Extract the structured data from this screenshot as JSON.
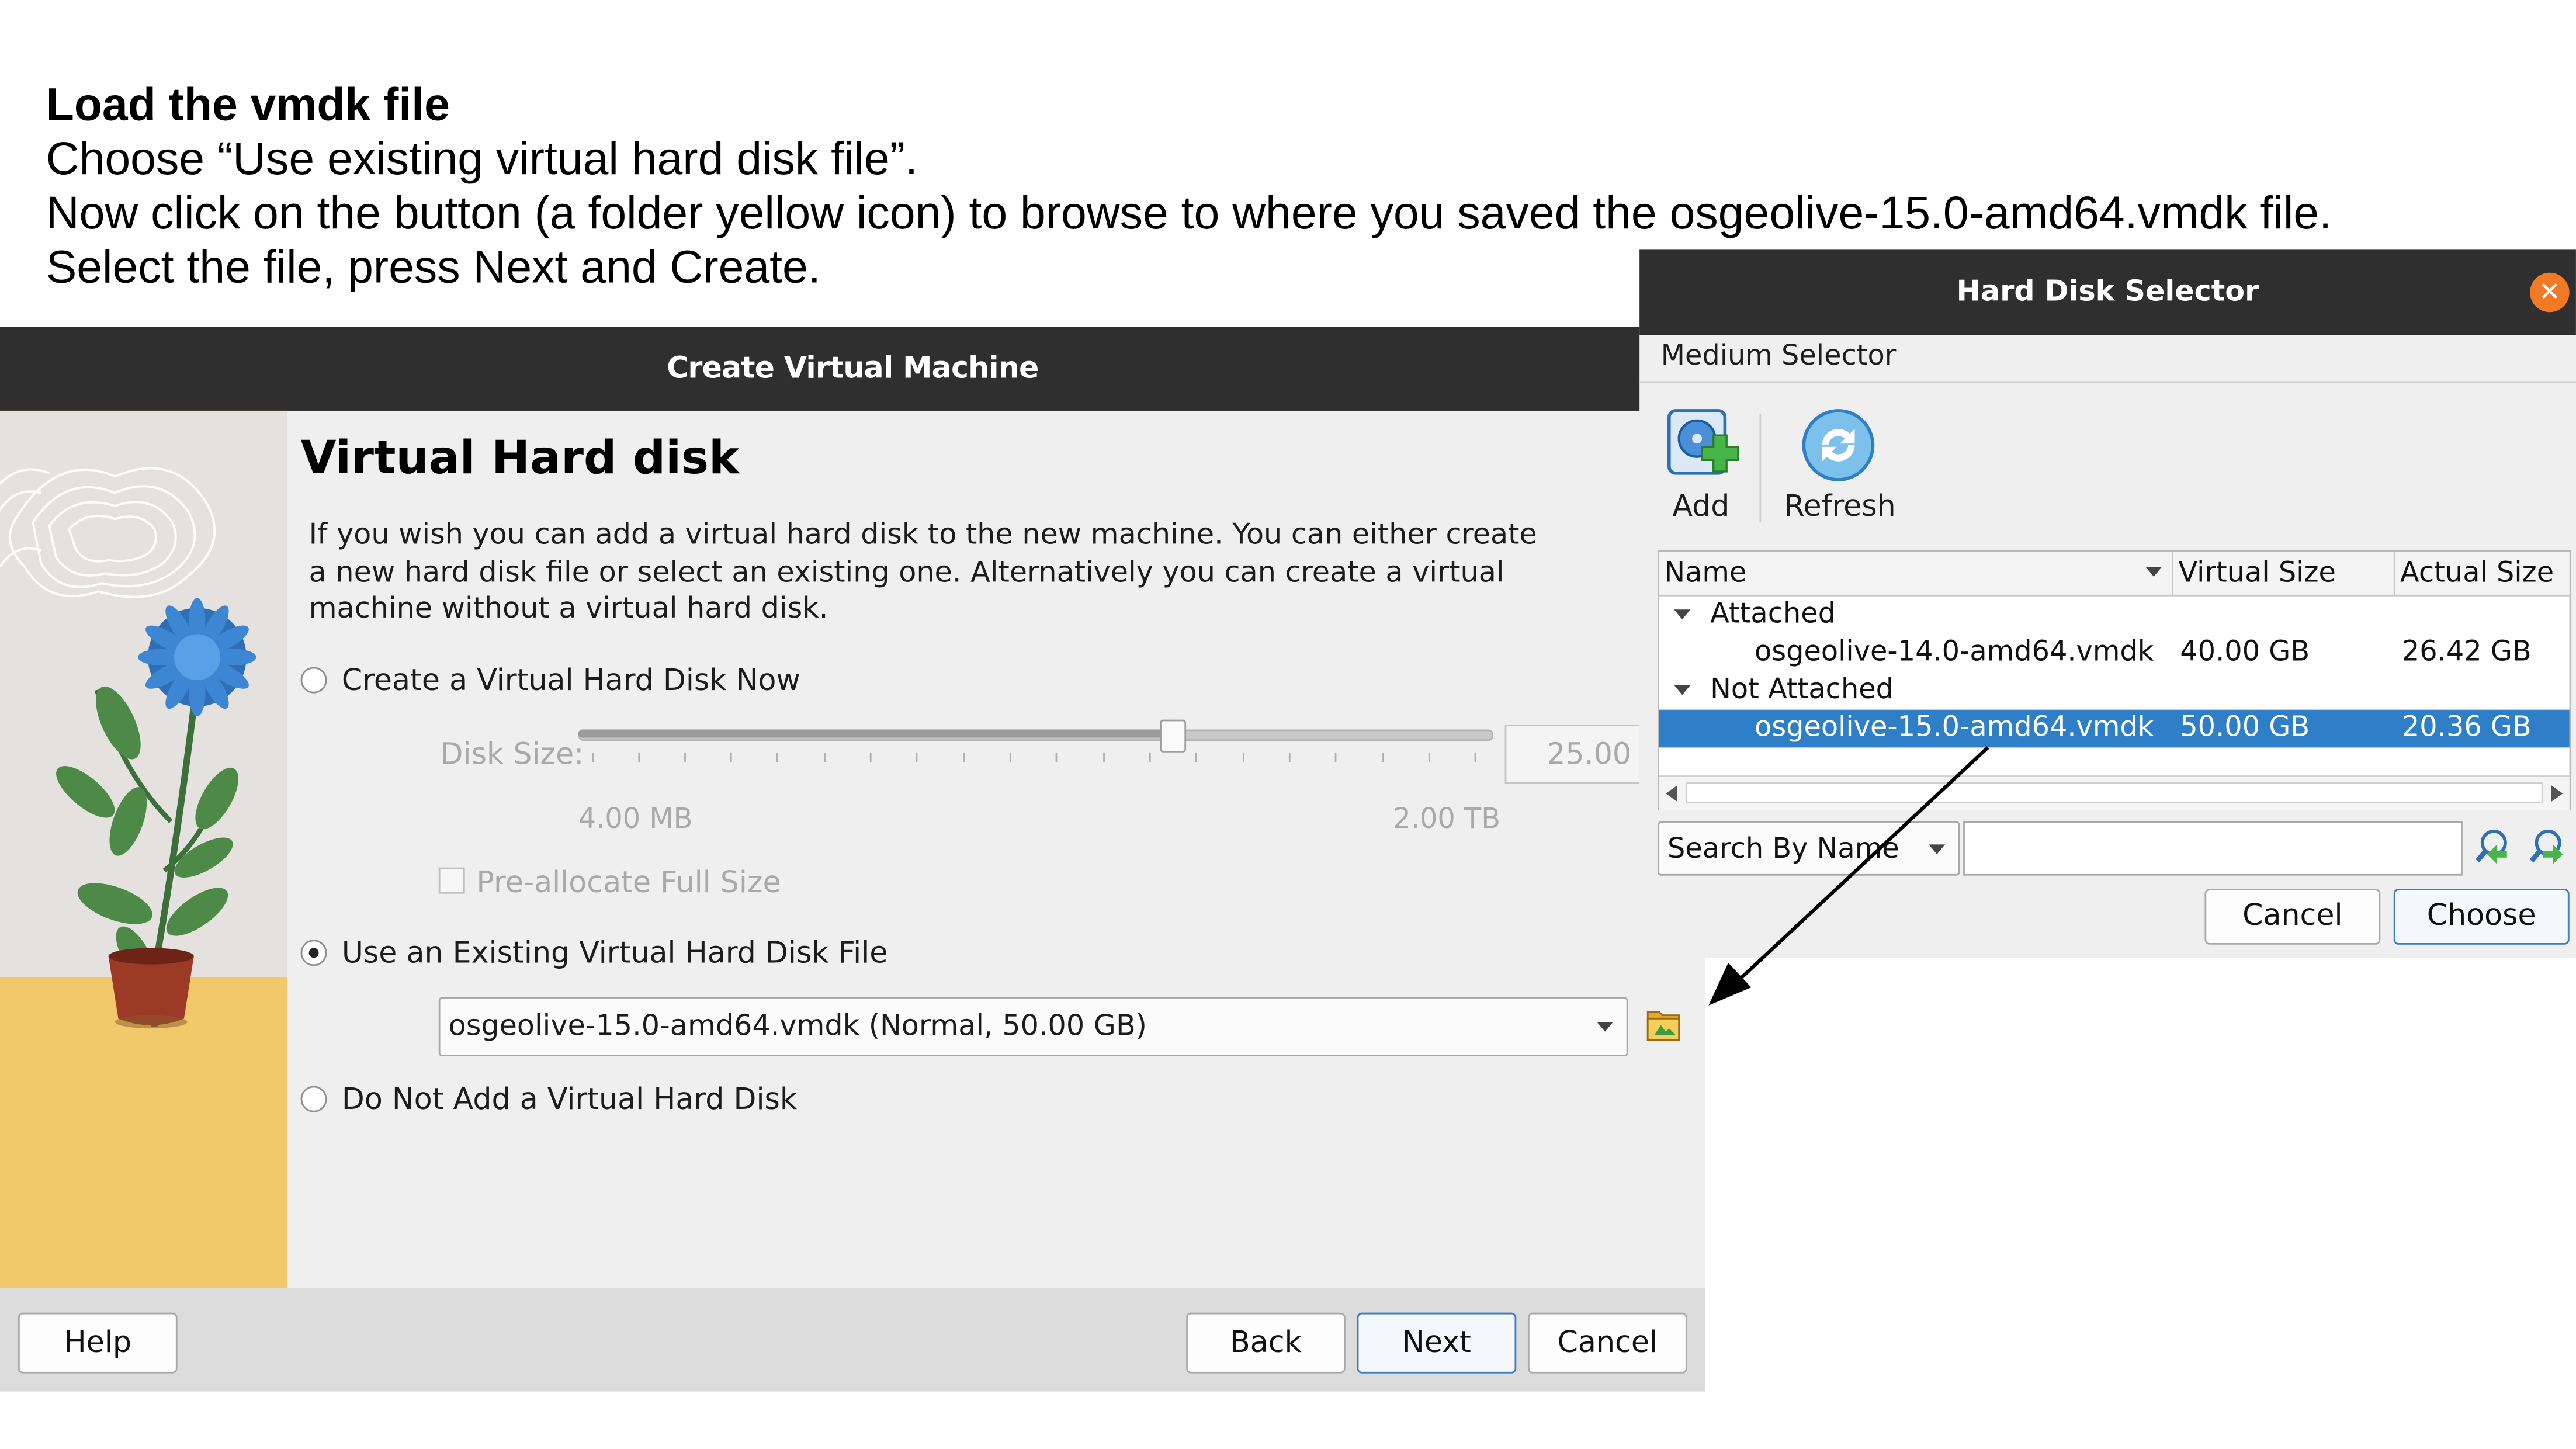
{
  "slide": {
    "title": "Load the vmdk file",
    "lines": [
      "Choose “Use existing virtual hard disk file”.",
      "Now click on the button (a folder yellow icon) to browse to where you saved the osgeolive-15.0-amd64.vmdk file.",
      "Select the file, press Next and Create."
    ]
  },
  "create_vm": {
    "window_title": "Create Virtual Machine",
    "section_title": "Virtual Hard disk",
    "description": "If you wish you can add a virtual hard disk to the new machine. You can either create a new hard disk file or select an existing one. Alternatively you can create a virtual machine without a virtual hard disk.",
    "options": {
      "create_now": "Create a Virtual Hard Disk Now",
      "use_existing": "Use an Existing Virtual Hard Disk File",
      "do_not_add": "Do Not Add a Virtual Hard Disk"
    },
    "selected_option": "use_existing",
    "disk_size": {
      "label": "Disk Size:",
      "value": "25.00",
      "min_label": "4.00 MB",
      "max_label": "2.00 TB",
      "slider_fraction": 0.65
    },
    "preallocate_label": "Pre-allocate Full Size",
    "existing_file_value": "osgeolive-15.0-amd64.vmdk (Normal, 50.00 GB)",
    "buttons": {
      "help": "Help",
      "back": "Back",
      "next": "Next",
      "cancel": "Cancel"
    }
  },
  "hard_disk_selector": {
    "window_title": "Hard Disk Selector",
    "menu": "Medium Selector",
    "toolbar": {
      "add": "Add",
      "refresh": "Refresh"
    },
    "columns": [
      "Name",
      "Virtual Size",
      "Actual Size"
    ],
    "groups": [
      {
        "label": "Attached",
        "items": [
          {
            "name": "osgeolive-14.0-amd64.vmdk",
            "virtual": "40.00 GB",
            "actual": "26.42 GB"
          }
        ]
      },
      {
        "label": "Not Attached",
        "items": [
          {
            "name": "osgeolive-15.0-amd64.vmdk",
            "virtual": "50.00 GB",
            "actual": "20.36 GB"
          }
        ]
      }
    ],
    "search_mode": "Search By Name",
    "search_value": "",
    "buttons": {
      "cancel": "Cancel",
      "choose": "Choose"
    }
  },
  "colors": {
    "titlebar": "#2f2f2f",
    "selection": "#2e7fc7",
    "close": "#f27a27",
    "art_floor": "#f1c96b"
  },
  "icons": [
    "close-icon",
    "add-disk-icon",
    "refresh-icon",
    "folder-icon",
    "chevron-down-icon",
    "search-forward-icon",
    "search-backward-icon"
  ]
}
